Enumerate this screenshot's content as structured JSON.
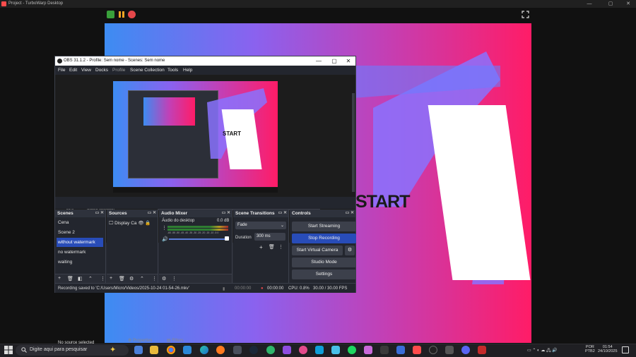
{
  "turbowarp": {
    "title": "Project - TurboWarp Desktop",
    "stage_text": "START"
  },
  "obs": {
    "title": "OBS 31.1.2 - Profile: Sem nome - Scenes: Sem nome",
    "menu": [
      "File",
      "Edit",
      "View",
      "Docks",
      "Profile",
      "Scene Collection",
      "Tools",
      "Help"
    ],
    "preview_text": "START",
    "zoom_minus": "−",
    "zoom_value": "31%",
    "zoom_scaled": "Scaled (596x335)",
    "no_source": "No source selected",
    "properties": "Properties",
    "filters": "Filters",
    "docks": {
      "scenes": {
        "title": "Scenes",
        "items": [
          "Cena",
          "Scene 2",
          "without watermark",
          "no watermark",
          "waiting"
        ],
        "selected_index": 2
      },
      "sources": {
        "title": "Sources",
        "items": [
          "Display Ca"
        ]
      },
      "mixer": {
        "title": "Audio Mixer",
        "channel": "Áudio do desktop",
        "level": "0.0 dB",
        "scale": "-60 -55 -50 -45 -40 -35 -30 -25 -20 -15 -10 -5 0"
      },
      "transitions": {
        "title": "Scene Transitions",
        "transition": "Fade",
        "duration_label": "Duration",
        "duration_value": "300 ms"
      },
      "controls": {
        "title": "Controls",
        "buttons": [
          "Start Streaming",
          "Stop Recording",
          "Start Virtual Camera",
          "Studio Mode",
          "Settings"
        ],
        "active_index": 1
      }
    },
    "status": {
      "message": "Recording saved to 'C:/Users/Micro/Videos/2025-10-24 01-54-26.mkv'",
      "stream_time": "00:00:00",
      "rec_time": "00:00:00",
      "cpu": "CPU: 0.8%",
      "fps": "30.00 / 30.00 FPS"
    }
  },
  "taskbar": {
    "search_placeholder": "Digite aqui para pesquisar",
    "language": "POR",
    "layout": "PTB2",
    "time": "01:54",
    "date": "24/10/2025"
  },
  "colors": {
    "accent": "#284cb8",
    "stage_gradient": [
      "#3d8cf2",
      "#8a62ef",
      "#c240b6",
      "#ff1c67"
    ],
    "record": "#e5474a",
    "flag": "#39a13b"
  }
}
